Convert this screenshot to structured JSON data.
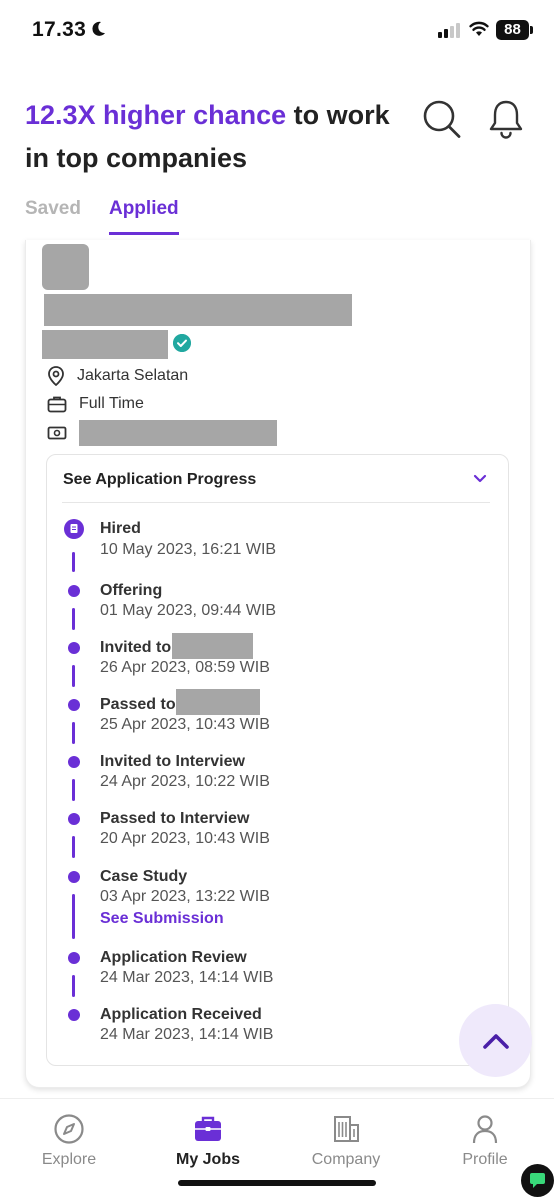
{
  "status_bar": {
    "time": "17.33",
    "battery": "88"
  },
  "header": {
    "headline_accent": "12.3X higher chance",
    "headline_rest": " to work in top companies"
  },
  "tabs": [
    {
      "label": "Saved",
      "active": false
    },
    {
      "label": "Applied",
      "active": true
    }
  ],
  "job": {
    "location": "Jakarta Selatan",
    "employment_type": "Full Time"
  },
  "progress": {
    "title": "See Application Progress",
    "steps": [
      {
        "title": "Hired",
        "date": "10 May 2023, 16:21 WIB"
      },
      {
        "title": "Offering",
        "date": "01 May 2023, 09:44 WIB"
      },
      {
        "title": "Invited to",
        "date": "26 Apr 2023, 08:59 WIB"
      },
      {
        "title": "Passed to",
        "date": "25 Apr 2023, 10:43 WIB"
      },
      {
        "title": "Invited to Interview",
        "date": "24 Apr 2023, 10:22 WIB"
      },
      {
        "title": "Passed to Interview",
        "date": "20 Apr 2023, 10:43 WIB"
      },
      {
        "title": "Case Study",
        "date": "03 Apr 2023, 13:22 WIB",
        "link": "See Submission"
      },
      {
        "title": "Application Review",
        "date": "24 Mar 2023, 14:14 WIB"
      },
      {
        "title": "Application Received",
        "date": "24 Mar 2023, 14:14 WIB"
      }
    ]
  },
  "bottom_nav": [
    {
      "label": "Explore",
      "icon": "compass-icon",
      "active": false
    },
    {
      "label": "My Jobs",
      "icon": "briefcase-icon",
      "active": true
    },
    {
      "label": "Company",
      "icon": "building-icon",
      "active": false
    },
    {
      "label": "Profile",
      "icon": "person-icon",
      "active": false
    }
  ],
  "colors": {
    "accent": "#6a2fd6",
    "verified": "#21a8a0",
    "redacted": "#a6a6a6"
  }
}
